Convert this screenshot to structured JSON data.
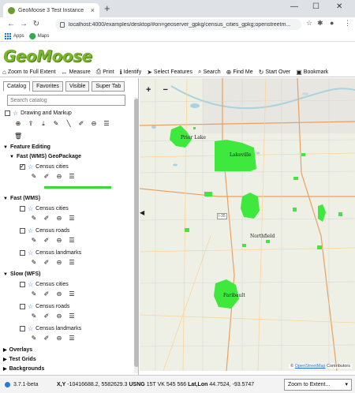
{
  "browser": {
    "tab_title": "GeoMoose 3 Test Instance",
    "tab_close": "×",
    "new_tab": "+",
    "url": "localhost:4000/examples/desktop/#on=geoserver_gpkg/census_cities_gpkg;openstreetm...",
    "bookmarks": [
      {
        "label": "Apps",
        "icon": "apps-icon"
      },
      {
        "label": "Maps",
        "icon": "maps-pin-icon"
      }
    ]
  },
  "app": {
    "logo": "GeoMoose",
    "toolbar": [
      {
        "label": "Zoom to Full Extent",
        "icon": "home-icon",
        "glyph": "⌂"
      },
      {
        "label": "Measure",
        "icon": "ruler-icon",
        "glyph": "↔"
      },
      {
        "label": "Print",
        "icon": "print-icon",
        "glyph": "⎙"
      },
      {
        "label": "Identify",
        "icon": "info-icon",
        "glyph": "ℹ"
      },
      {
        "label": "Select Features",
        "icon": "pointer-icon",
        "glyph": "➤"
      },
      {
        "label": "Search",
        "icon": "search-icon",
        "glyph": "⌕"
      },
      {
        "label": "Find Me",
        "icon": "crosshair-icon",
        "glyph": "⊕"
      },
      {
        "label": "Start Over",
        "icon": "refresh-icon",
        "glyph": "↻"
      },
      {
        "label": "Bookmark",
        "icon": "bookmark-icon",
        "glyph": "▣"
      }
    ]
  },
  "catalog": {
    "tabs": [
      "Catalog",
      "Favorites",
      "Visible",
      "Super Tab"
    ],
    "search_placeholder": "Search catalog",
    "drawing_layer": "Drawing and Markup",
    "groups": {
      "feature_editing": "Feature Editing",
      "fast_wms_gpkg": "Fast (WMS) GeoPackage",
      "fast_wms": "Fast (WMS)",
      "slow_wfs": "Slow (WFS)",
      "overlays": "Overlays",
      "test_grids": "Test Grids",
      "backgrounds": "Backgrounds"
    },
    "layers": {
      "census_cities_gpkg": "Census cities",
      "fast_census_cities": "Census cities",
      "fast_census_roads": "Census roads",
      "fast_census_landmarks": "Census landmarks",
      "slow_census_cities": "Census cities",
      "slow_census_roads": "Census roads",
      "slow_census_landmarks": "Census landmarks"
    }
  },
  "map": {
    "zoom_in": "+",
    "zoom_out": "−",
    "city_labels": [
      "Prior Lake",
      "Lakeville",
      "Northfield",
      "Faribault"
    ],
    "highway": "I-35",
    "attribution_prefix": "©",
    "attribution_link": "OpenStreetMap",
    "attribution_suffix": " Contributors",
    "highlight_color": "#3ee83c"
  },
  "footer": {
    "version": "3.7.1-beta",
    "coords_label_xy": "X,Y",
    "coords_xy": "-10416688.2, 5582629.3",
    "coords_label_usng": "USNG",
    "coords_usng": "15T VK 545 566",
    "coords_label_latlon": "Lat,Lon",
    "coords_latlon": "44.7524, -93.5747",
    "zoom_select": "Zoom to Extent..."
  }
}
